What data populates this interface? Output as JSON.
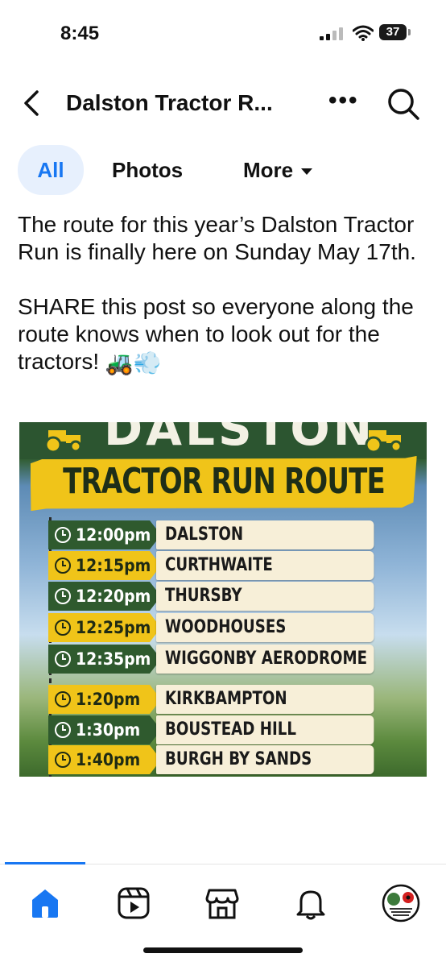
{
  "status": {
    "time": "8:45",
    "battery": "37"
  },
  "header": {
    "title": "Dalston Tractor R...",
    "more": "•••"
  },
  "tabs": [
    {
      "label": "All"
    },
    {
      "label": "Photos"
    },
    {
      "label": "More"
    }
  ],
  "post": {
    "paragraph1": "The route for this year’s Dalston Tractor Run is finally here on Sunday May 17th.",
    "paragraph2": "SHARE this post so everyone along the route knows when to look out for the tractors!",
    "emoji": "🚜💨"
  },
  "poster": {
    "top_text": "DALSTON",
    "banner": "TRACTOR RUN ROUTE",
    "stops": [
      {
        "time": "12:00pm",
        "place": "DALSTON",
        "color": "green"
      },
      {
        "time": "12:15pm",
        "place": "CURTHWAITE",
        "color": "yellow"
      },
      {
        "time": "12:20pm",
        "place": "THURSBY",
        "color": "green"
      },
      {
        "time": "12:25pm",
        "place": "WOODHOUSES",
        "color": "yellow"
      },
      {
        "time": "12:35pm",
        "place": "WIGGONBY AERODROME",
        "color": "green"
      },
      {
        "time": "1:20pm",
        "place": "KIRKBAMPTON",
        "color": "yellow"
      },
      {
        "time": "1:30pm",
        "place": "BOUSTEAD HILL",
        "color": "green"
      },
      {
        "time": "1:40pm",
        "place": "BURGH BY SANDS",
        "color": "yellow"
      }
    ]
  },
  "nav": {
    "items": [
      "home-icon",
      "video-icon",
      "marketplace-icon",
      "notifications-icon",
      "profile-avatar"
    ],
    "accent": "#1877f2"
  }
}
